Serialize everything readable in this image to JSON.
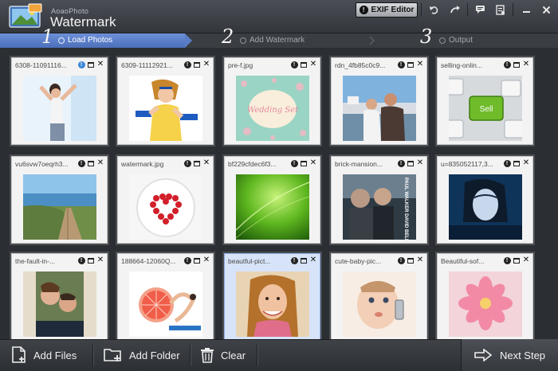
{
  "app": {
    "subtitle": "AoaoPhoto",
    "title": "Watermark"
  },
  "header": {
    "exif_label": "EXIF Editor"
  },
  "steps": [
    {
      "num": "1",
      "label": "Load Photos",
      "active": true
    },
    {
      "num": "2",
      "label": "Add Watermark",
      "active": false
    },
    {
      "num": "3",
      "label": "Output",
      "active": false
    }
  ],
  "photos": [
    {
      "name": "6308-11091116...",
      "info_color": "blue",
      "thumb": "woman-stretch"
    },
    {
      "name": "6309-11112921...",
      "info_color": "black",
      "thumb": "woman-dumbbell"
    },
    {
      "name": "pre-f.jpg",
      "info_color": "black",
      "thumb": "wedding-card"
    },
    {
      "name": "rdn_4fb85c0c9...",
      "info_color": "black",
      "thumb": "couple-harbor"
    },
    {
      "name": "selling-onlin...",
      "info_color": "black",
      "thumb": "sell-key"
    },
    {
      "name": "vu6svw7oeqrh3...",
      "info_color": "black",
      "thumb": "boardwalk-beach"
    },
    {
      "name": "watermark.jpg",
      "info_color": "black",
      "thumb": "heart-plate"
    },
    {
      "name": "bf229cfdec6f3...",
      "info_color": "black",
      "thumb": "green-abstract"
    },
    {
      "name": "brick-mansion...",
      "info_color": "black",
      "thumb": "movie-poster"
    },
    {
      "name": "u=835052117,3...",
      "info_color": "black",
      "thumb": "blue-portrait"
    },
    {
      "name": "the-fault-in-...",
      "info_color": "black",
      "thumb": "couple-poster"
    },
    {
      "name": "188664-12060Q...",
      "info_color": "black",
      "thumb": "yoga-grapefruit"
    },
    {
      "name": "beautful-pict...",
      "info_color": "black",
      "thumb": "smiling-girl",
      "selected": true
    },
    {
      "name": "cute-baby-pic...",
      "info_color": "black",
      "thumb": "baby-phone"
    },
    {
      "name": "Beautiful-sof...",
      "info_color": "black",
      "thumb": "pink-flower"
    }
  ],
  "poster_text": {
    "wedding": "Wedding Set",
    "sell": "Sell",
    "movie": "PAUL WALKER DAVID BELLE RZA"
  },
  "bottom": {
    "add_files": "Add Files",
    "add_folder": "Add Folder",
    "clear": "Clear",
    "next_step": "Next Step"
  },
  "colors": {
    "accent": "#5a7dc6",
    "background": "#2b2e33"
  }
}
